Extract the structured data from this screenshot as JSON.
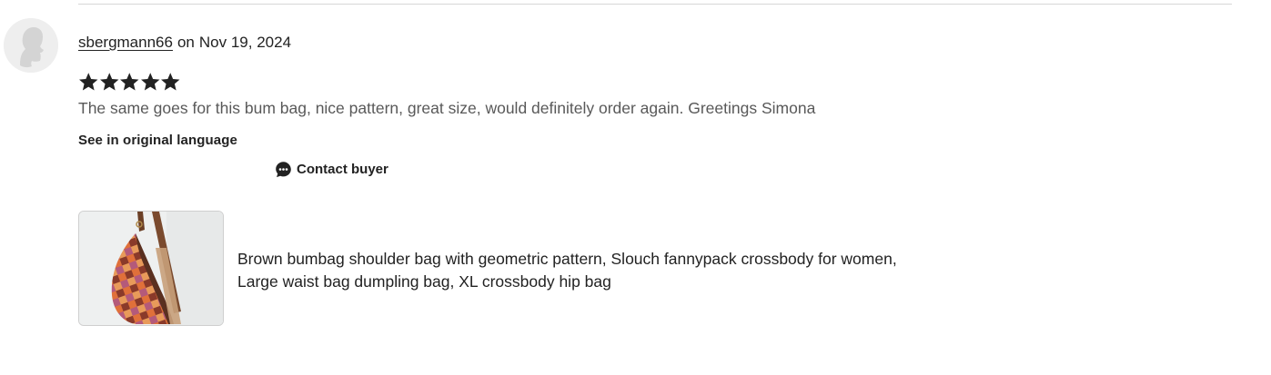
{
  "review": {
    "username": "sbergmann66",
    "date_prefix": "on",
    "date": "Nov 19, 2024",
    "rating": 5,
    "rating_max": 5,
    "text": "The same goes for this bum bag, nice pattern, great size, would definitely order again. Greetings Simona",
    "see_original_label": "See in original language",
    "contact_label": "Contact buyer",
    "star_color": "#222222"
  },
  "listing": {
    "title_line1": "Brown bumbag shoulder bag with geometric pattern, Slouch fannypack crossbody for women,",
    "title_line2": "Large waist bag dumpling bag, XL crossbody hip bag"
  },
  "icons": {
    "avatar": "default-avatar-icon",
    "star": "star-icon",
    "contact": "chat-bubble-icon"
  }
}
